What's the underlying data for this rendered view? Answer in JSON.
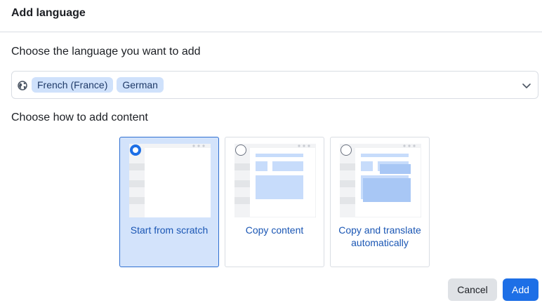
{
  "dialog": {
    "title": "Add language",
    "language_label": "Choose the language you want to add",
    "languages": [
      "French (France)",
      "German"
    ],
    "content_label": "Choose how to add content",
    "options": [
      {
        "label": "Start from scratch",
        "selected": true
      },
      {
        "label": "Copy content",
        "selected": false
      },
      {
        "label": "Copy and translate automatically",
        "selected": false
      }
    ],
    "cancel_label": "Cancel",
    "add_label": "Add"
  },
  "icons": {
    "language_select": "globe-icon",
    "dropdown": "chevron-down-icon",
    "card_menu": "more-dots-icon"
  },
  "colors": {
    "accent": "#1d6fe6",
    "chip_bg": "#cfe1fb",
    "selected_card_bg": "#d3e3fb",
    "caption_text": "#1a56b4",
    "thumb_highlight": "#c7dcfb"
  }
}
